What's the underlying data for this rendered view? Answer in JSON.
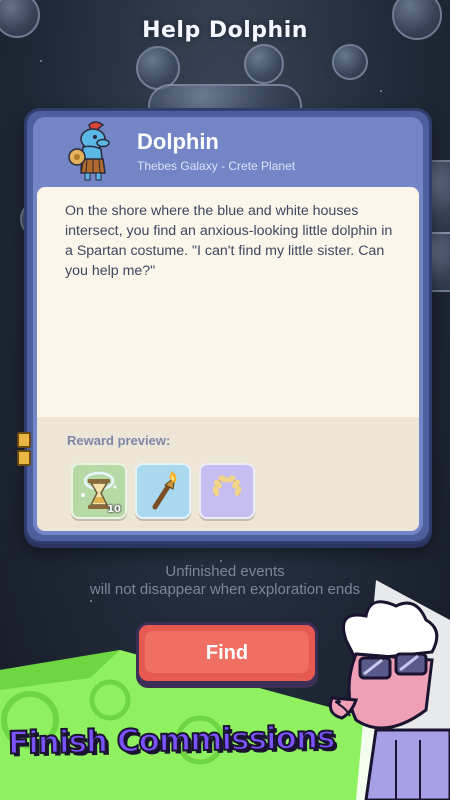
{
  "screen": {
    "title": "Help Dolphin"
  },
  "event": {
    "character_name": "Dolphin",
    "location": "Thebes Galaxy - Crete Planet",
    "description": "On the shore where the blue and white houses intersect, you find an anxious-looking little dolphin in a Spartan costume. \"I can't find my little sister. Can you help me?\"",
    "reward_label": "Reward preview:",
    "rewards": [
      {
        "icon": "hourglass-icon",
        "quantity": "10",
        "color": "#b7d9a6"
      },
      {
        "icon": "torch-icon",
        "quantity": "",
        "color": "#a9d8ef"
      },
      {
        "icon": "laurel-wreath-icon",
        "quantity": "",
        "color": "#c6bdf0"
      }
    ]
  },
  "notice": {
    "line1": "Unfinished events",
    "line2": "will not disappear when exploration ends"
  },
  "find_button": {
    "label": "Find"
  },
  "promo": {
    "banner_text": "Finish Commissions"
  },
  "colors": {
    "card_frame": "#4d5f9e",
    "button": "#e65a52",
    "banner": "#7a52ff",
    "ground": "#8ff060"
  }
}
